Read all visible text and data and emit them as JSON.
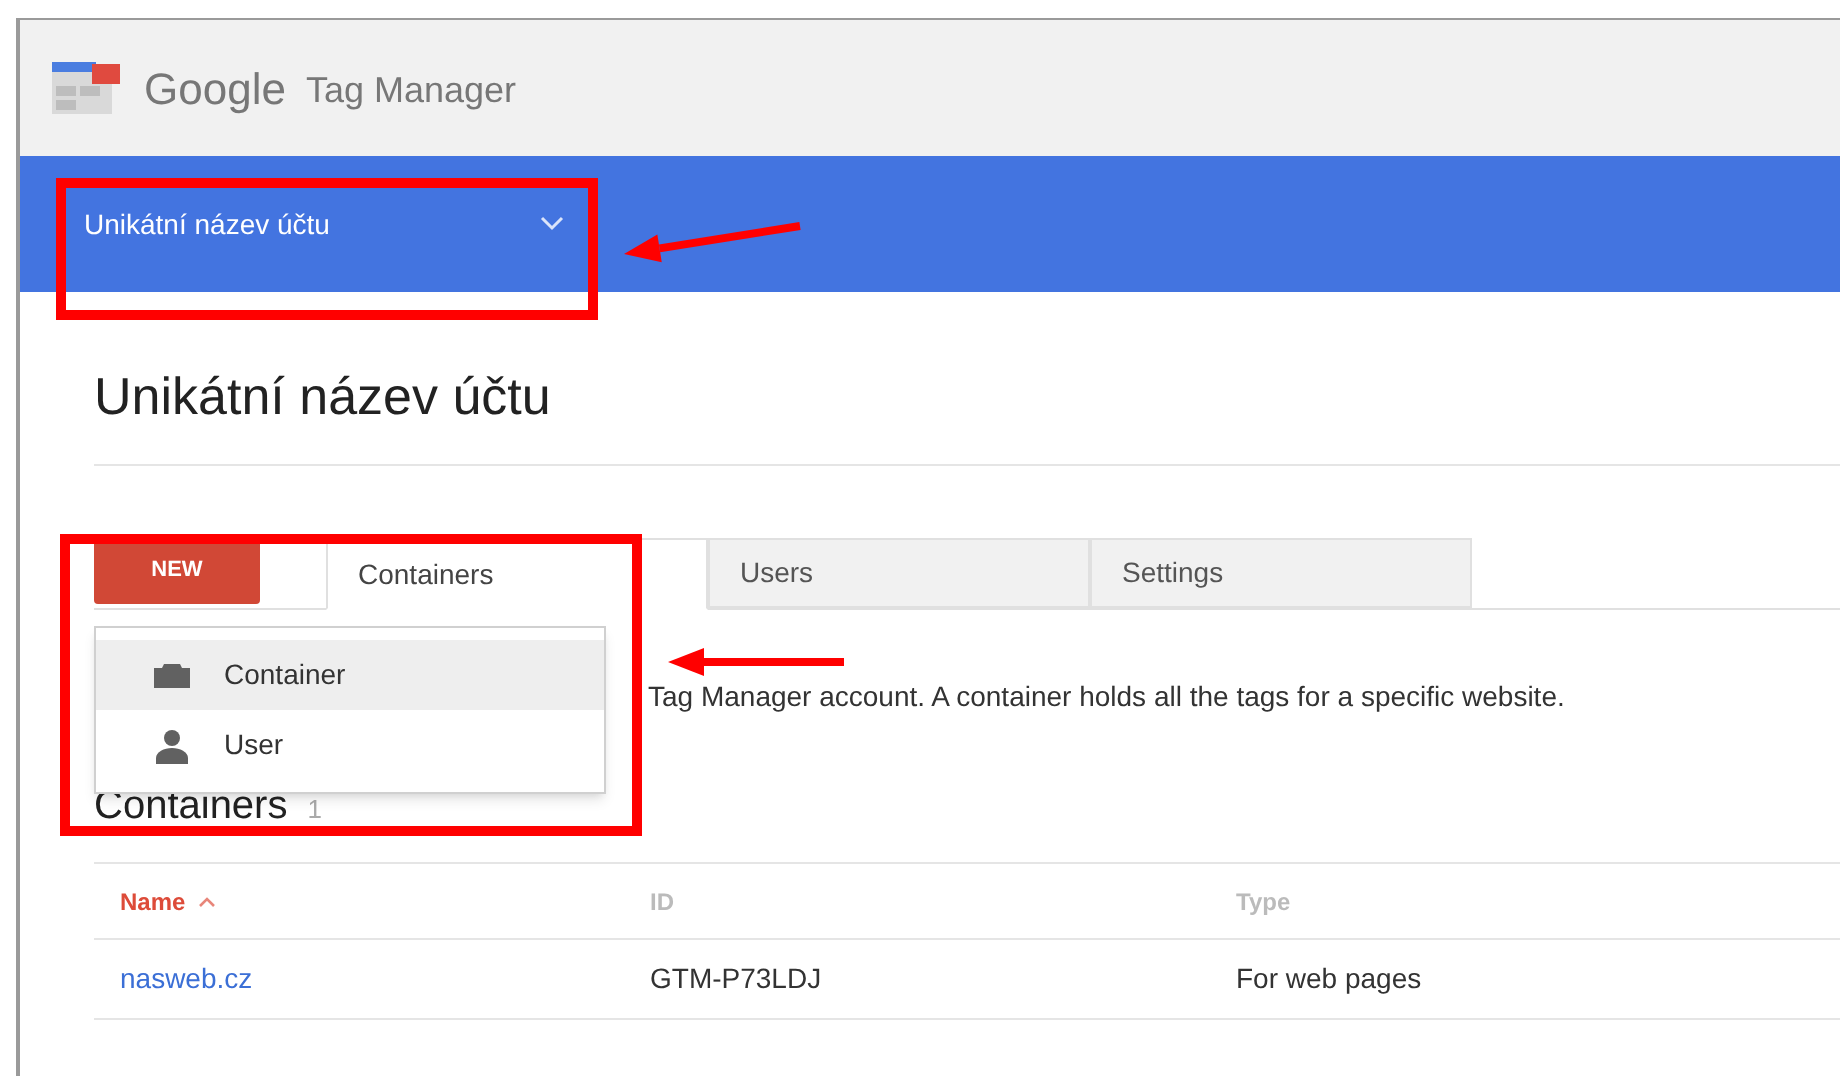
{
  "header": {
    "brand": "Google",
    "product": "Tag Manager"
  },
  "account_bar": {
    "account": "Unikátní název účtu"
  },
  "page_title": "Unikátní název účtu",
  "new_button": "NEW",
  "tabs": [
    {
      "label": "Containers",
      "selected": true
    },
    {
      "label": "Users",
      "selected": false
    },
    {
      "label": "Settings",
      "selected": false
    }
  ],
  "new_menu": [
    {
      "label": "Container",
      "kind": "container",
      "selected": true
    },
    {
      "label": "User",
      "kind": "user",
      "selected": false
    }
  ],
  "description": "Tag Manager account. A container holds all the tags for a specific website.",
  "section": {
    "title": "Containers",
    "count": "1"
  },
  "table": {
    "columns": [
      {
        "label": "Name",
        "sorted": true
      },
      {
        "label": "ID",
        "sorted": false
      },
      {
        "label": "Type",
        "sorted": false
      }
    ],
    "rows": [
      [
        "nasweb.cz",
        "GTM-P73LDJ",
        "For web pages"
      ]
    ]
  }
}
